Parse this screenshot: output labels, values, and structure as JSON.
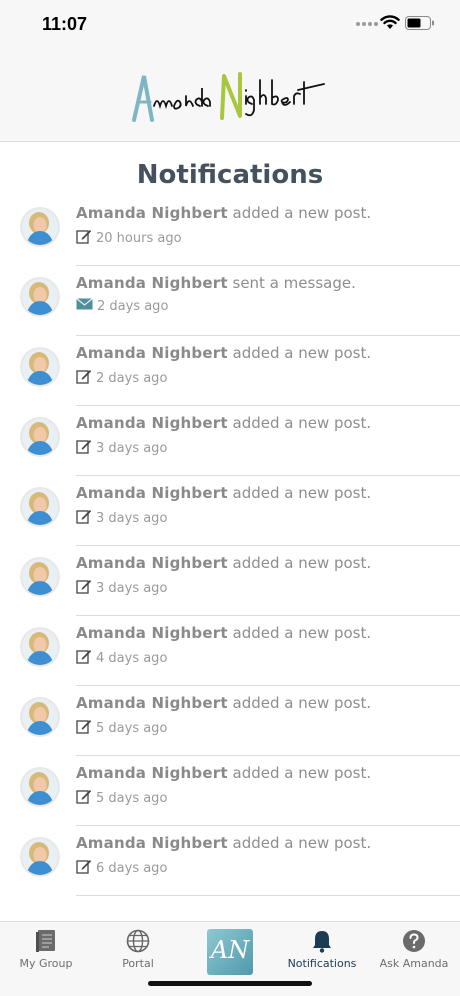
{
  "status_bar": {
    "time": "11:07"
  },
  "header": {
    "logo_text": "Amanda Nighbert"
  },
  "page_title": "Notifications",
  "notifications": [
    {
      "name": "Amanda Nighbert",
      "action": "added a new post.",
      "icon": "edit-icon",
      "time": "20 hours ago"
    },
    {
      "name": "Amanda Nighbert",
      "action": "sent a message.",
      "icon": "envelope-icon",
      "time": "2 days ago"
    },
    {
      "name": "Amanda Nighbert",
      "action": "added a new post.",
      "icon": "edit-icon",
      "time": "2 days ago"
    },
    {
      "name": "Amanda Nighbert",
      "action": "added a new post.",
      "icon": "edit-icon",
      "time": "3 days ago"
    },
    {
      "name": "Amanda Nighbert",
      "action": "added a new post.",
      "icon": "edit-icon",
      "time": "3 days ago"
    },
    {
      "name": "Amanda Nighbert",
      "action": "added a new post.",
      "icon": "edit-icon",
      "time": "3 days ago"
    },
    {
      "name": "Amanda Nighbert",
      "action": "added a new post.",
      "icon": "edit-icon",
      "time": "4 days ago"
    },
    {
      "name": "Amanda Nighbert",
      "action": "added a new post.",
      "icon": "edit-icon",
      "time": "5 days ago"
    },
    {
      "name": "Amanda Nighbert",
      "action": "added a new post.",
      "icon": "edit-icon",
      "time": "5 days ago"
    },
    {
      "name": "Amanda Nighbert",
      "action": "added a new post.",
      "icon": "edit-icon",
      "time": "6 days ago"
    }
  ],
  "tab_bar": {
    "tabs": [
      {
        "label": "My Group",
        "icon": "book-icon"
      },
      {
        "label": "Portal",
        "icon": "globe-icon"
      },
      {
        "label": "AN",
        "icon": "app-logo"
      },
      {
        "label": "Notifications",
        "icon": "bell-icon",
        "active": true
      },
      {
        "label": "Ask Amanda",
        "icon": "question-icon"
      }
    ]
  },
  "colors": {
    "accent": "#1d3b52",
    "title": "#45525d",
    "logo_teal": "#7fb6c6",
    "logo_green": "#a9c73e"
  }
}
